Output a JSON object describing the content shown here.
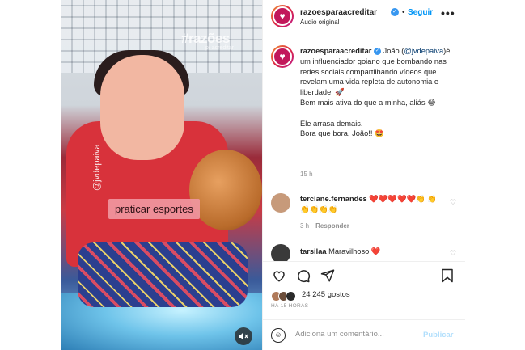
{
  "video": {
    "watermark": "#razões",
    "watermark_sub": "p/ acreditar",
    "vertical_handle": "@jvdepaiva",
    "caption": "praticar esportes",
    "mute_icon": "speaker-muted-icon"
  },
  "header": {
    "username": "razoesparaacreditar",
    "verified": "✓",
    "separator": "•",
    "follow_label": "Seguir",
    "audio_label": "Áudio original",
    "more_label": "•••"
  },
  "post": {
    "username": "razoesparaacreditar",
    "caption_pre": " João (",
    "mention": "@jvdepaiva",
    "caption_line1": ")é um influenciador goiano que bombando nas redes sociais compartilhando vídeos que revelam uma vida repleta de autonomia e liberdade. 🚀",
    "caption_line2": "Bem mais ativa do que a minha, aliás 😂",
    "caption_line3": "Ele arrasa demais.",
    "caption_line4": "Bora que bora, João!! 🤩",
    "time": "15 h"
  },
  "comments": [
    {
      "user": "terciane.fernandes",
      "text": " ❤️❤️❤️❤️❤️👏 👏👏👏👏👏",
      "time": "3 h",
      "reply_label": "Responder",
      "avatar_color": "#c79a7a"
    },
    {
      "user": "tarsilaa",
      "text": " Maravilhoso ❤️",
      "avatar_color": "#3a3a3a"
    }
  ],
  "actions": {
    "like_icon": "heart-icon",
    "comment_icon": "comment-icon",
    "share_icon": "share-icon",
    "save_icon": "bookmark-icon",
    "likes_count": "24 245 gostos",
    "time_ago": "HÁ 15 HORAS"
  },
  "add_comment": {
    "emoji_icon": "emoji-icon",
    "placeholder": "Adiciona um comentário...",
    "publish_label": "Publicar"
  },
  "colors": {
    "accent_blue": "#0095f6",
    "publish_disabled": "#b2dffc",
    "verified_blue": "#3897f0",
    "muted_text": "#8e8e8e",
    "like_red": "#ed4956"
  }
}
